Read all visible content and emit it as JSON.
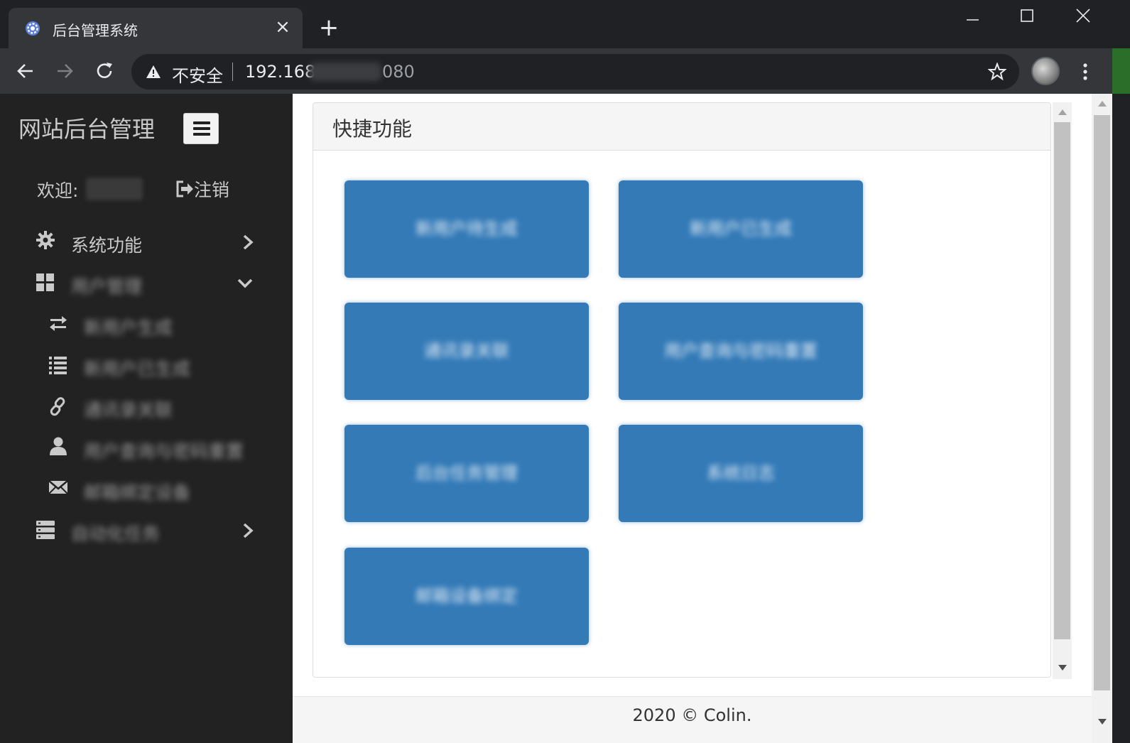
{
  "browser": {
    "tab_title": "后台管理系统",
    "insecure_label": "不安全",
    "url_prefix": "192.168",
    "url_suffix": "080",
    "new_tab_label": "+",
    "close_tab_label": "×"
  },
  "sidebar": {
    "brand": "网站后台管理",
    "welcome_label": "欢迎:",
    "logout_label": "注销",
    "items": [
      {
        "label": "系统功能",
        "icon": "gear-icon",
        "chevron": "right"
      },
      {
        "label": "用户管理",
        "icon": "grid-icon",
        "chevron": "down"
      },
      {
        "label": "新用户生成",
        "icon": "exchange-icon"
      },
      {
        "label": "新用户已生成",
        "icon": "list-icon"
      },
      {
        "label": "通讯录关联",
        "icon": "link-icon"
      },
      {
        "label": "用户查询与密码重置",
        "icon": "user-icon"
      },
      {
        "label": "邮箱绑定设备",
        "icon": "envelope-icon"
      },
      {
        "label": "自动化任务",
        "icon": "server-icon",
        "chevron": "right"
      }
    ]
  },
  "panel": {
    "title": "快捷功能",
    "buttons": [
      "新用户待生成",
      "新用户已生成",
      "通讯录关联",
      "用户查询与密码重置",
      "后台任务管理",
      "系统日志",
      "邮箱设备绑定"
    ]
  },
  "footer": {
    "text": "2020 © Colin."
  },
  "colors": {
    "sidebar_bg": "#222222",
    "button_primary": "#337ab7",
    "chrome_bg": "#202124",
    "toolbar_bg": "#35363a"
  }
}
